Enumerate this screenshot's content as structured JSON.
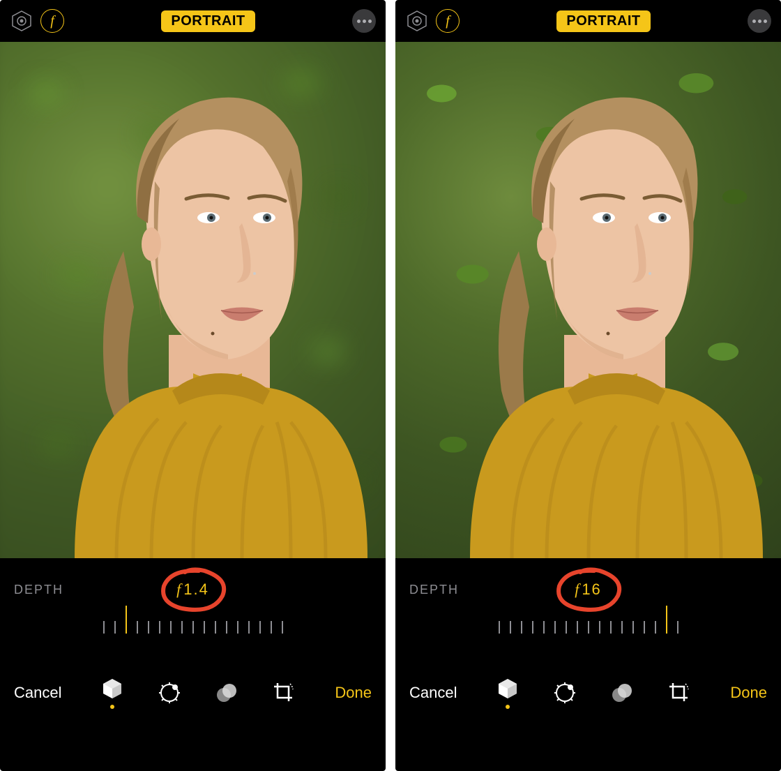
{
  "colors": {
    "accent": "#f5c518",
    "annotation": "#e7442c",
    "bg": "#000000",
    "muted": "#8e8e93"
  },
  "screens": [
    {
      "topbar": {
        "mode_label": "PORTRAIT"
      },
      "depth": {
        "label": "DEPTH",
        "f_prefix": "f",
        "f_value": "1.4"
      },
      "slider": {
        "tick_count": 17,
        "indicator_index": 2
      },
      "bottombar": {
        "cancel": "Cancel",
        "done": "Done",
        "active_tool_index": 0
      },
      "photo": {
        "background_blurred": true
      }
    },
    {
      "topbar": {
        "mode_label": "PORTRAIT"
      },
      "depth": {
        "label": "DEPTH",
        "f_prefix": "f",
        "f_value": "16"
      },
      "slider": {
        "tick_count": 17,
        "indicator_index": 15
      },
      "bottombar": {
        "cancel": "Cancel",
        "done": "Done",
        "active_tool_index": 0
      },
      "photo": {
        "background_blurred": false
      }
    }
  ]
}
